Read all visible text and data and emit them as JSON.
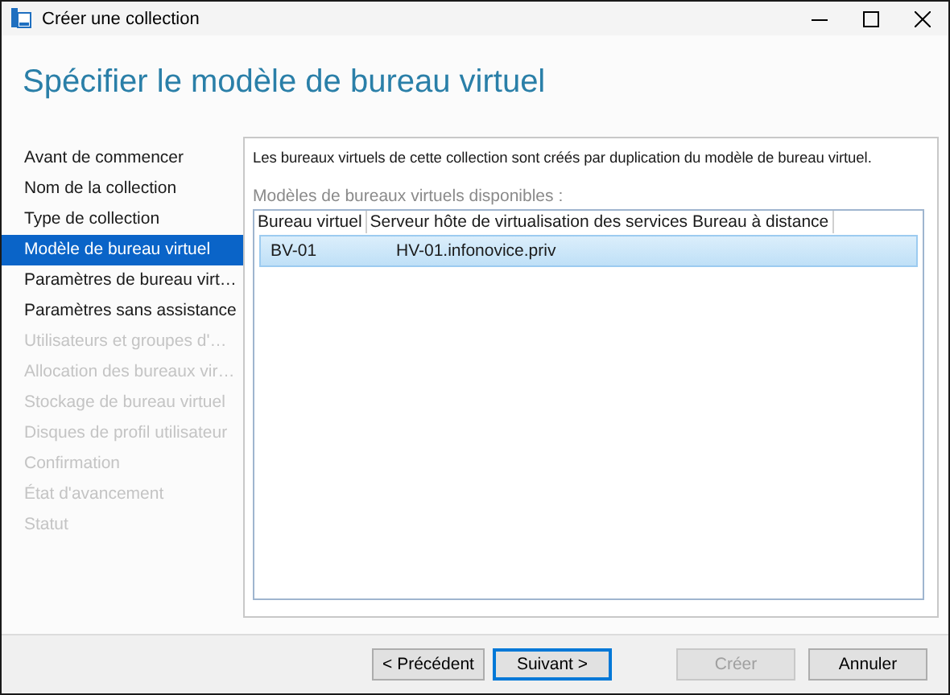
{
  "window": {
    "title": "Créer une collection"
  },
  "page_title": "Spécifier le modèle de bureau virtuel",
  "sidebar": {
    "items": [
      {
        "label": "Avant de commencer",
        "selected": false,
        "disabled": false
      },
      {
        "label": "Nom de la collection",
        "selected": false,
        "disabled": false
      },
      {
        "label": "Type de collection",
        "selected": false,
        "disabled": false
      },
      {
        "label": "Modèle de bureau virtuel",
        "selected": true,
        "disabled": false
      },
      {
        "label": "Paramètres de bureau virt…",
        "selected": false,
        "disabled": false
      },
      {
        "label": "Paramètres sans assistance",
        "selected": false,
        "disabled": false
      },
      {
        "label": "Utilisateurs et groupes d'…",
        "selected": false,
        "disabled": true
      },
      {
        "label": "Allocation des bureaux vir…",
        "selected": false,
        "disabled": true
      },
      {
        "label": "Stockage de bureau virtuel",
        "selected": false,
        "disabled": true
      },
      {
        "label": "Disques de profil utilisateur",
        "selected": false,
        "disabled": true
      },
      {
        "label": "Confirmation",
        "selected": false,
        "disabled": true
      },
      {
        "label": "État d'avancement",
        "selected": false,
        "disabled": true
      },
      {
        "label": "Statut",
        "selected": false,
        "disabled": true
      }
    ]
  },
  "description": "Les bureaux virtuels de cette collection sont créés par duplication du modèle de bureau virtuel.",
  "table": {
    "label": "Modèles de bureaux virtuels disponibles :",
    "columns": [
      "Bureau virtuel",
      "Serveur hôte de virtualisation des services Bureau à distance"
    ],
    "rows": [
      {
        "cells": [
          "BV-01",
          "HV-01.infonovice.priv"
        ],
        "selected": true
      }
    ]
  },
  "buttons": [
    {
      "label": "< Précédent",
      "disabled": false,
      "default": false
    },
    {
      "label": "Suivant >",
      "disabled": false,
      "default": true
    },
    {
      "label": "Créer",
      "disabled": true,
      "default": false
    },
    {
      "label": "Annuler",
      "disabled": false,
      "default": false
    }
  ]
}
